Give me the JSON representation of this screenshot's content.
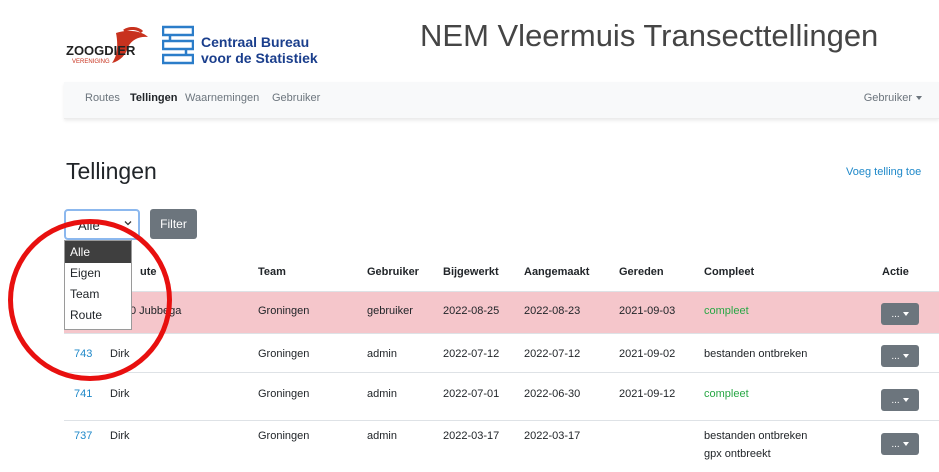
{
  "header": {
    "logo_zoogdier_text": "ZOOGDIER",
    "logo_zoogdier_sub": "VERENIGING",
    "cbs_line1": "Centraal Bureau",
    "cbs_line2": "voor de Statistiek",
    "app_title": "NEM Vleermuis Transecttellingen"
  },
  "nav": {
    "items": [
      "Routes",
      "Tellingen",
      "Waarnemingen",
      "Gebruiker"
    ],
    "active": "Tellingen",
    "user_menu": "Gebruiker"
  },
  "page": {
    "title": "Tellingen",
    "add_link": "Voeg telling toe"
  },
  "filter": {
    "selected": "Alle",
    "button": "Filter",
    "options": [
      "Alle",
      "Eigen",
      "Team",
      "Route"
    ]
  },
  "table": {
    "headers": [
      "Route",
      "Team",
      "Gebruiker",
      "Bijgewerkt",
      "Aangemaakt",
      "Gereden",
      "Compleet",
      "Actie"
    ],
    "header_route_visible": "ute",
    "rows": [
      {
        "id": "",
        "route": "0 Jubbega",
        "team": "Groningen",
        "user": "gebruiker",
        "updated": "2022-08-25",
        "created": "2022-08-23",
        "driven": "2021-09-03",
        "complete": "compleet",
        "complete2": "",
        "action": "...",
        "highlight": true
      },
      {
        "id": "743",
        "route": "Dirk",
        "team": "Groningen",
        "user": "admin",
        "updated": "2022-07-12",
        "created": "2022-07-12",
        "driven": "2021-09-02",
        "complete": "bestanden ontbreken",
        "complete2": "",
        "action": "...",
        "highlight": false
      },
      {
        "id": "741",
        "route": "Dirk",
        "team": "Groningen",
        "user": "admin",
        "updated": "2022-07-01",
        "created": "2022-06-30",
        "driven": "2021-09-12",
        "complete": "compleet",
        "complete2": "",
        "action": "...",
        "highlight": false
      },
      {
        "id": "737",
        "route": "Dirk",
        "team": "Groningen",
        "user": "admin",
        "updated": "2022-03-17",
        "created": "2022-03-17",
        "driven": "",
        "complete": "bestanden ontbreken",
        "complete2": "gpx ontbreekt",
        "action": "...",
        "highlight": false
      }
    ]
  },
  "colors": {
    "highlight_row": "#f5c6cb",
    "link": "#1e88c9",
    "complete_green": "#28a745",
    "annotation_circle": "#e8100f",
    "button_gray": "#6c757d"
  }
}
